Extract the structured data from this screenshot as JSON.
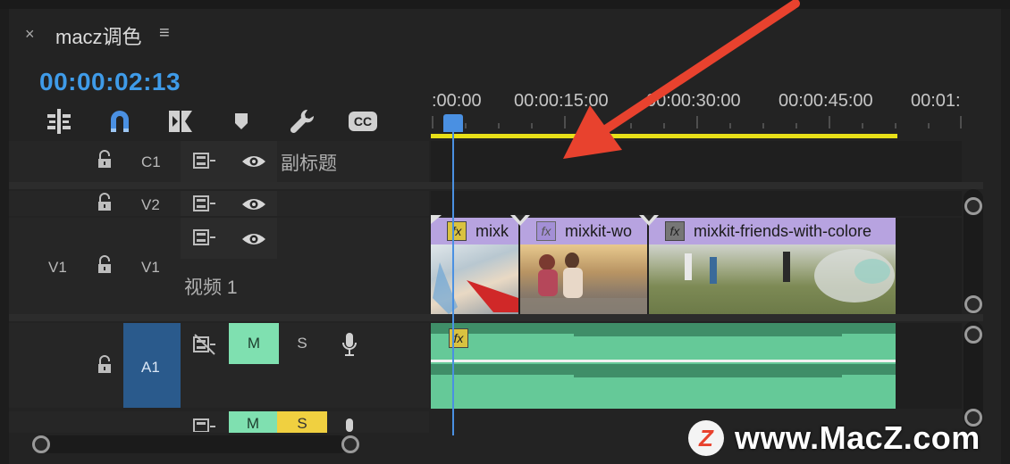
{
  "panel": {
    "close_glyph": "×",
    "title": "macz调色",
    "menu_glyph": "≡"
  },
  "timecode": "00:00:02:13",
  "toolbar": {
    "icons": [
      "insert-edit-icon",
      "snap-magnet-icon",
      "linked-selection-icon",
      "add-marker-icon",
      "wrench-settings-icon",
      "captions-cc-icon"
    ],
    "cc_label": "CC"
  },
  "ruler": {
    "labels": [
      ":00:00",
      "00:00:15:00",
      "00:00:30:00",
      "00:00:45:00",
      "00:01:"
    ]
  },
  "tracks": {
    "c1": {
      "target": "",
      "name": "C1",
      "label": "副标题"
    },
    "v2": {
      "target": "",
      "name": "V2"
    },
    "v1": {
      "target": "V1",
      "name": "V1",
      "label": "视频 1"
    },
    "a1": {
      "target": "",
      "name": "A1",
      "mute": "M",
      "solo": "S"
    },
    "a2": {
      "mute": "M",
      "solo": "S"
    }
  },
  "clips": [
    {
      "name": "mixk",
      "fx": "fx"
    },
    {
      "name": "mixkit-wo",
      "fx": "fx"
    },
    {
      "name": "mixkit-friends-with-colore",
      "fx": "fx"
    }
  ],
  "audio_clip": {
    "fx": "fx"
  },
  "watermark": {
    "text": "www.MacZ.com",
    "logo_letter": "Z"
  },
  "colors": {
    "accent_blue": "#3f9be8",
    "video_clip_header": "#b7a3e0",
    "audio_clip": "#65c998",
    "mute_button": "#7fe0b0",
    "solo_button": "#f0d040",
    "work_area_bar": "#e8e018",
    "arrow": "#e8422e"
  }
}
